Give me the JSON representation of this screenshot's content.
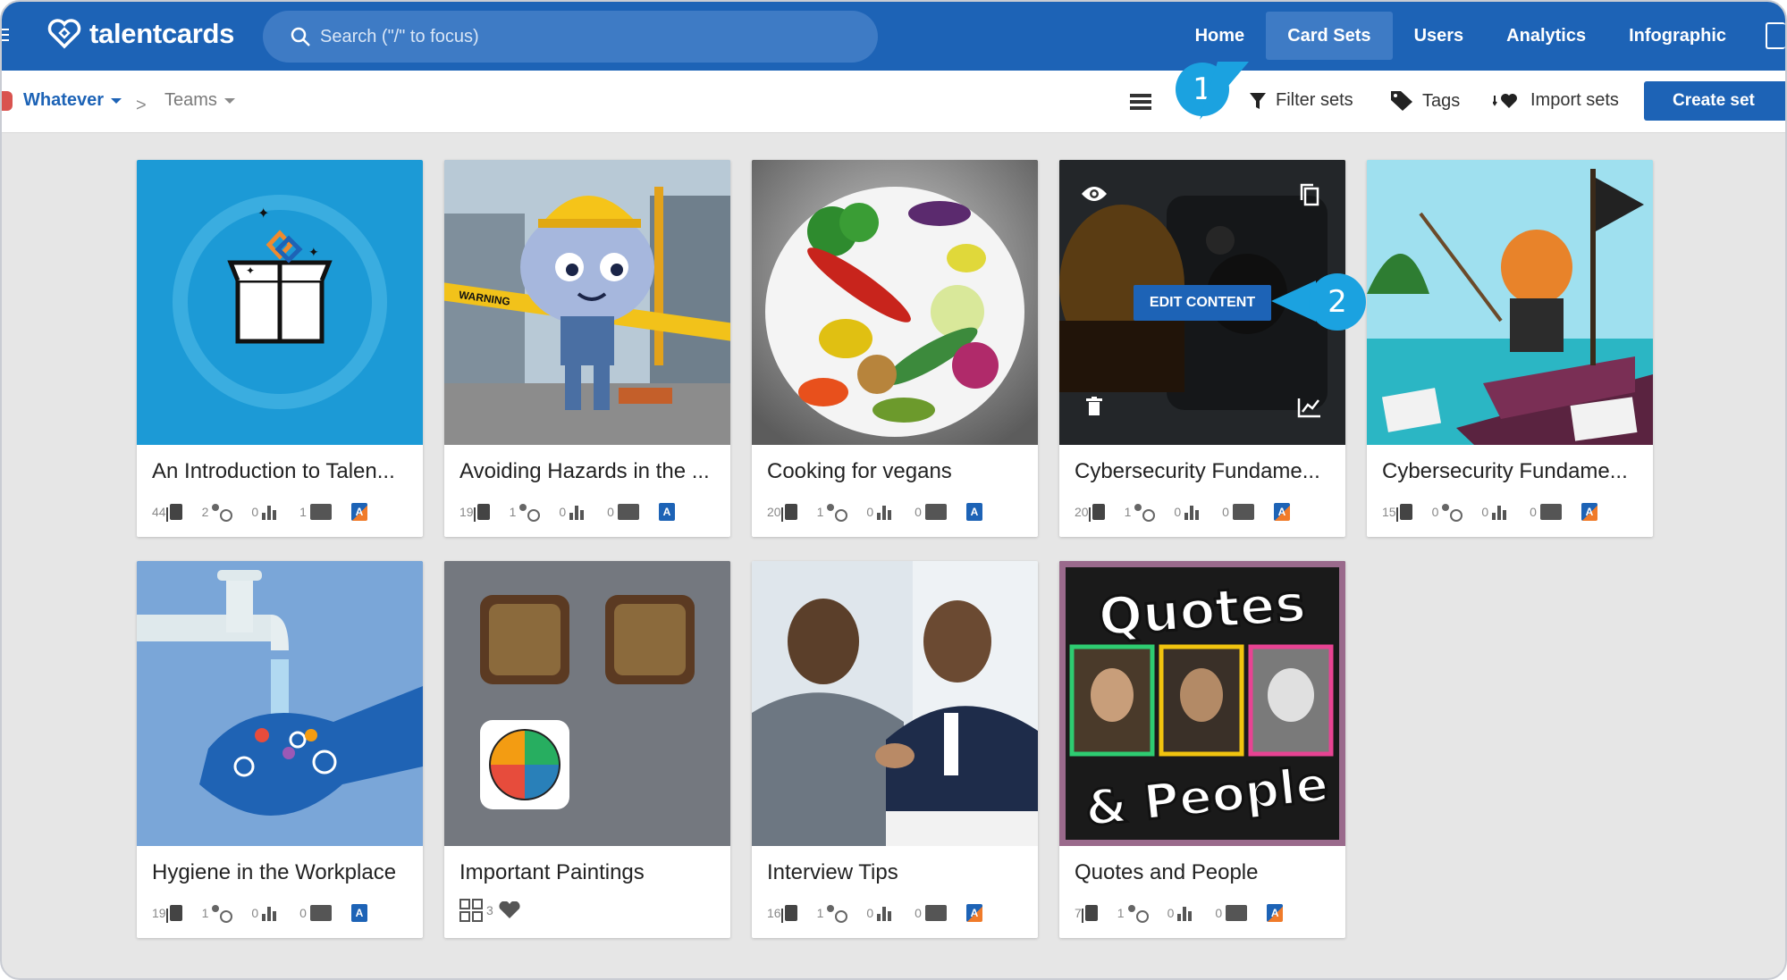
{
  "app": {
    "logo_text": "talentcards",
    "search_placeholder": "Search (\"/\" to focus)",
    "nav": [
      {
        "label": "Home",
        "active": false
      },
      {
        "label": "Card Sets",
        "active": true
      },
      {
        "label": "Users",
        "active": false
      },
      {
        "label": "Analytics",
        "active": false
      },
      {
        "label": "Infographic",
        "active": false
      }
    ]
  },
  "toolbar": {
    "workspace": "Whatever",
    "separator": ">",
    "team": "Teams",
    "filter_label": "Filter sets",
    "tags_label": "Tags",
    "import_label": "Import sets",
    "create_label": "Create set"
  },
  "callouts": {
    "one": "1",
    "two": "2"
  },
  "card_overlay": {
    "edit_label": "EDIT CONTENT"
  },
  "cards": [
    {
      "title": "An Introduction to Talen...",
      "cards": "44",
      "users": "2",
      "analytics": "0",
      "feedback": "1",
      "badge": "A"
    },
    {
      "title": "Avoiding Hazards in the ...",
      "cards": "19",
      "users": "1",
      "analytics": "0",
      "feedback": "0",
      "badge": "A"
    },
    {
      "title": "Cooking for vegans",
      "cards": "20",
      "users": "1",
      "analytics": "0",
      "feedback": "0",
      "badge": "A"
    },
    {
      "title": "Cybersecurity Fundame...",
      "cards": "20",
      "users": "1",
      "analytics": "0",
      "feedback": "0",
      "badge": "A"
    },
    {
      "title": "Cybersecurity Fundame...",
      "cards": "15",
      "users": "0",
      "analytics": "0",
      "feedback": "0",
      "badge": "A"
    },
    {
      "title": "Hygiene in the Workplace",
      "cards": "19",
      "users": "1",
      "analytics": "0",
      "feedback": "0",
      "badge": "A"
    },
    {
      "title": "Important Paintings",
      "sets": "3"
    },
    {
      "title": "Interview Tips",
      "cards": "16",
      "users": "1",
      "analytics": "0",
      "feedback": "0",
      "badge": "A"
    },
    {
      "title": "Quotes and People",
      "cards": "7",
      "users": "1",
      "analytics": "0",
      "feedback": "0",
      "badge": "A"
    }
  ],
  "quotes_art": {
    "line1": "Quotes",
    "line2": "& People"
  },
  "hazard_art": {
    "tape": "WARNING"
  }
}
